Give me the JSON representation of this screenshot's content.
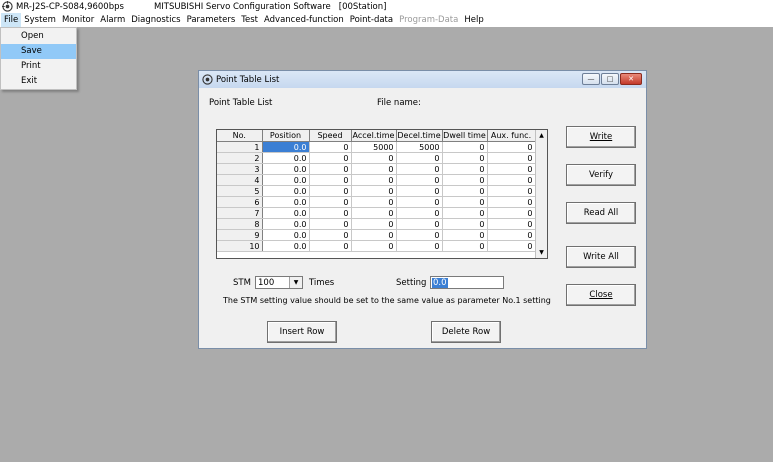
{
  "app": {
    "title_app": "MR-J2S-CP-S084,9600bps",
    "title_software": "MITSUBISHI Servo Configuration Software",
    "title_station": "[00Station]"
  },
  "menu": {
    "items": [
      "File",
      "System",
      "Monitor",
      "Alarm",
      "Diagnostics",
      "Parameters",
      "Test",
      "Advanced-function",
      "Point-data",
      "Program-Data",
      "Help"
    ],
    "disabled": [
      "Program-Data"
    ],
    "active": "File"
  },
  "file_menu": {
    "items": [
      "Open",
      "Save",
      "Print",
      "Exit"
    ],
    "selected": "Save"
  },
  "dialog": {
    "title": "Point Table List",
    "heading": "Point Table List",
    "file_name_label": "File name:",
    "table": {
      "headers": [
        "No.",
        "Position",
        "Speed",
        "Accel.time",
        "Decel.time",
        "Dwell time",
        "Aux. func."
      ],
      "rows": [
        [
          "1",
          "0.0",
          "0",
          "5000",
          "5000",
          "0",
          "0"
        ],
        [
          "2",
          "0.0",
          "0",
          "0",
          "0",
          "0",
          "0"
        ],
        [
          "3",
          "0.0",
          "0",
          "0",
          "0",
          "0",
          "0"
        ],
        [
          "4",
          "0.0",
          "0",
          "0",
          "0",
          "0",
          "0"
        ],
        [
          "5",
          "0.0",
          "0",
          "0",
          "0",
          "0",
          "0"
        ],
        [
          "6",
          "0.0",
          "0",
          "0",
          "0",
          "0",
          "0"
        ],
        [
          "7",
          "0.0",
          "0",
          "0",
          "0",
          "0",
          "0"
        ],
        [
          "8",
          "0.0",
          "0",
          "0",
          "0",
          "0",
          "0"
        ],
        [
          "9",
          "0.0",
          "0",
          "0",
          "0",
          "0",
          "0"
        ],
        [
          "10",
          "0.0",
          "0",
          "0",
          "0",
          "0",
          "0"
        ]
      ]
    },
    "stm_label": "STM",
    "stm_value": "100",
    "times_label": "Times",
    "setting_label": "Setting",
    "setting_value": "0.0",
    "note": "The STM setting value should be set to the same value as parameter No.1 setting",
    "buttons": {
      "write": "Write",
      "verify": "Verify",
      "read_all": "Read All",
      "write_all": "Write All",
      "close": "Close",
      "insert_row": "Insert Row",
      "delete_row": "Delete Row"
    },
    "colors": {
      "selection": "#3b7fd4",
      "menu_highlight": "#91c9f7"
    }
  }
}
